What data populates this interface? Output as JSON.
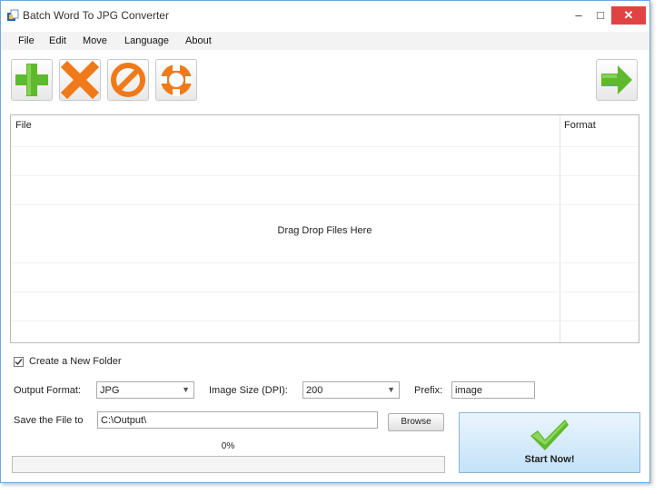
{
  "window": {
    "title": "Batch Word To JPG Converter",
    "min_glyph": "–",
    "max_glyph": "□",
    "close_glyph": "✕"
  },
  "menu": {
    "items": [
      "File",
      "Edit",
      "Move",
      "Language",
      "About"
    ]
  },
  "toolbar": {
    "buttons": [
      {
        "name": "add",
        "icon": "plus-icon",
        "color": "#5fb92e"
      },
      {
        "name": "remove",
        "icon": "x-icon",
        "color": "#f07a1a"
      },
      {
        "name": "clear",
        "icon": "prohibit-icon",
        "color": "#f07a1a"
      },
      {
        "name": "help",
        "icon": "lifebuoy-icon",
        "color": "#f07a1a"
      },
      {
        "name": "next",
        "icon": "arrow-right-icon",
        "color": "#5fb92e"
      }
    ]
  },
  "file_list": {
    "columns": [
      "File",
      "Format"
    ],
    "drop_hint": "Drag  Drop Files Here",
    "rows": []
  },
  "options": {
    "create_folder_label": "Create a New Folder",
    "create_folder_checked": true,
    "output_format_label": "Output Format:",
    "output_format_value": "JPG",
    "image_size_label": "Image Size (DPI):",
    "image_size_value": "200",
    "prefix_label": "Prefix:",
    "prefix_value": "image",
    "save_label": "Save the File to",
    "save_path": "C:\\Output\\",
    "browse_label": "Browse"
  },
  "progress": {
    "text": "0%",
    "fraction": 0
  },
  "start": {
    "label": "Start Now!"
  },
  "colors": {
    "accent_green": "#5fb92e",
    "accent_orange": "#f07a1a",
    "close_red": "#e04343",
    "start_bg": "#c3e2f8"
  }
}
